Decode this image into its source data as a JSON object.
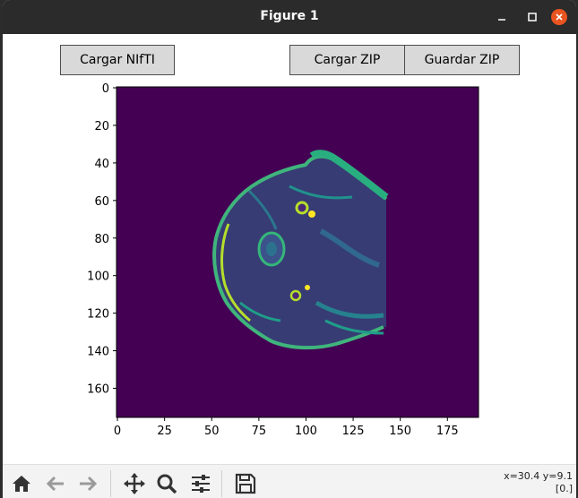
{
  "window": {
    "title": "Figure 1"
  },
  "buttons": {
    "load_nifti": "Cargar NIfTI",
    "load_zip": "Cargar ZIP",
    "save_zip": "Guardar ZIP"
  },
  "plot": {
    "type": "image",
    "colormap": "viridis",
    "x_ticks": [
      "0",
      "25",
      "50",
      "75",
      "100",
      "125",
      "150",
      "175"
    ],
    "y_ticks": [
      "0",
      "20",
      "40",
      "60",
      "80",
      "100",
      "120",
      "140",
      "160"
    ],
    "x_tick_values": [
      0,
      25,
      50,
      75,
      100,
      125,
      150,
      175
    ],
    "y_tick_values": [
      0,
      20,
      40,
      60,
      80,
      100,
      120,
      140,
      160
    ],
    "xlim": [
      -0.5,
      191.5
    ],
    "ylim": [
      175.5,
      -0.5
    ]
  },
  "toolbar": {
    "icons": [
      "home-icon",
      "back-arrow-icon",
      "forward-arrow-icon",
      "pan-icon",
      "zoom-icon",
      "configure-subplots-icon",
      "save-icon"
    ],
    "coord_line1": "x=30.4 y=9.1",
    "coord_line2": "[0.]"
  },
  "colors": {
    "image_background": "#440154",
    "titlebar": "#2b2b2b",
    "close_button": "#e95420"
  }
}
